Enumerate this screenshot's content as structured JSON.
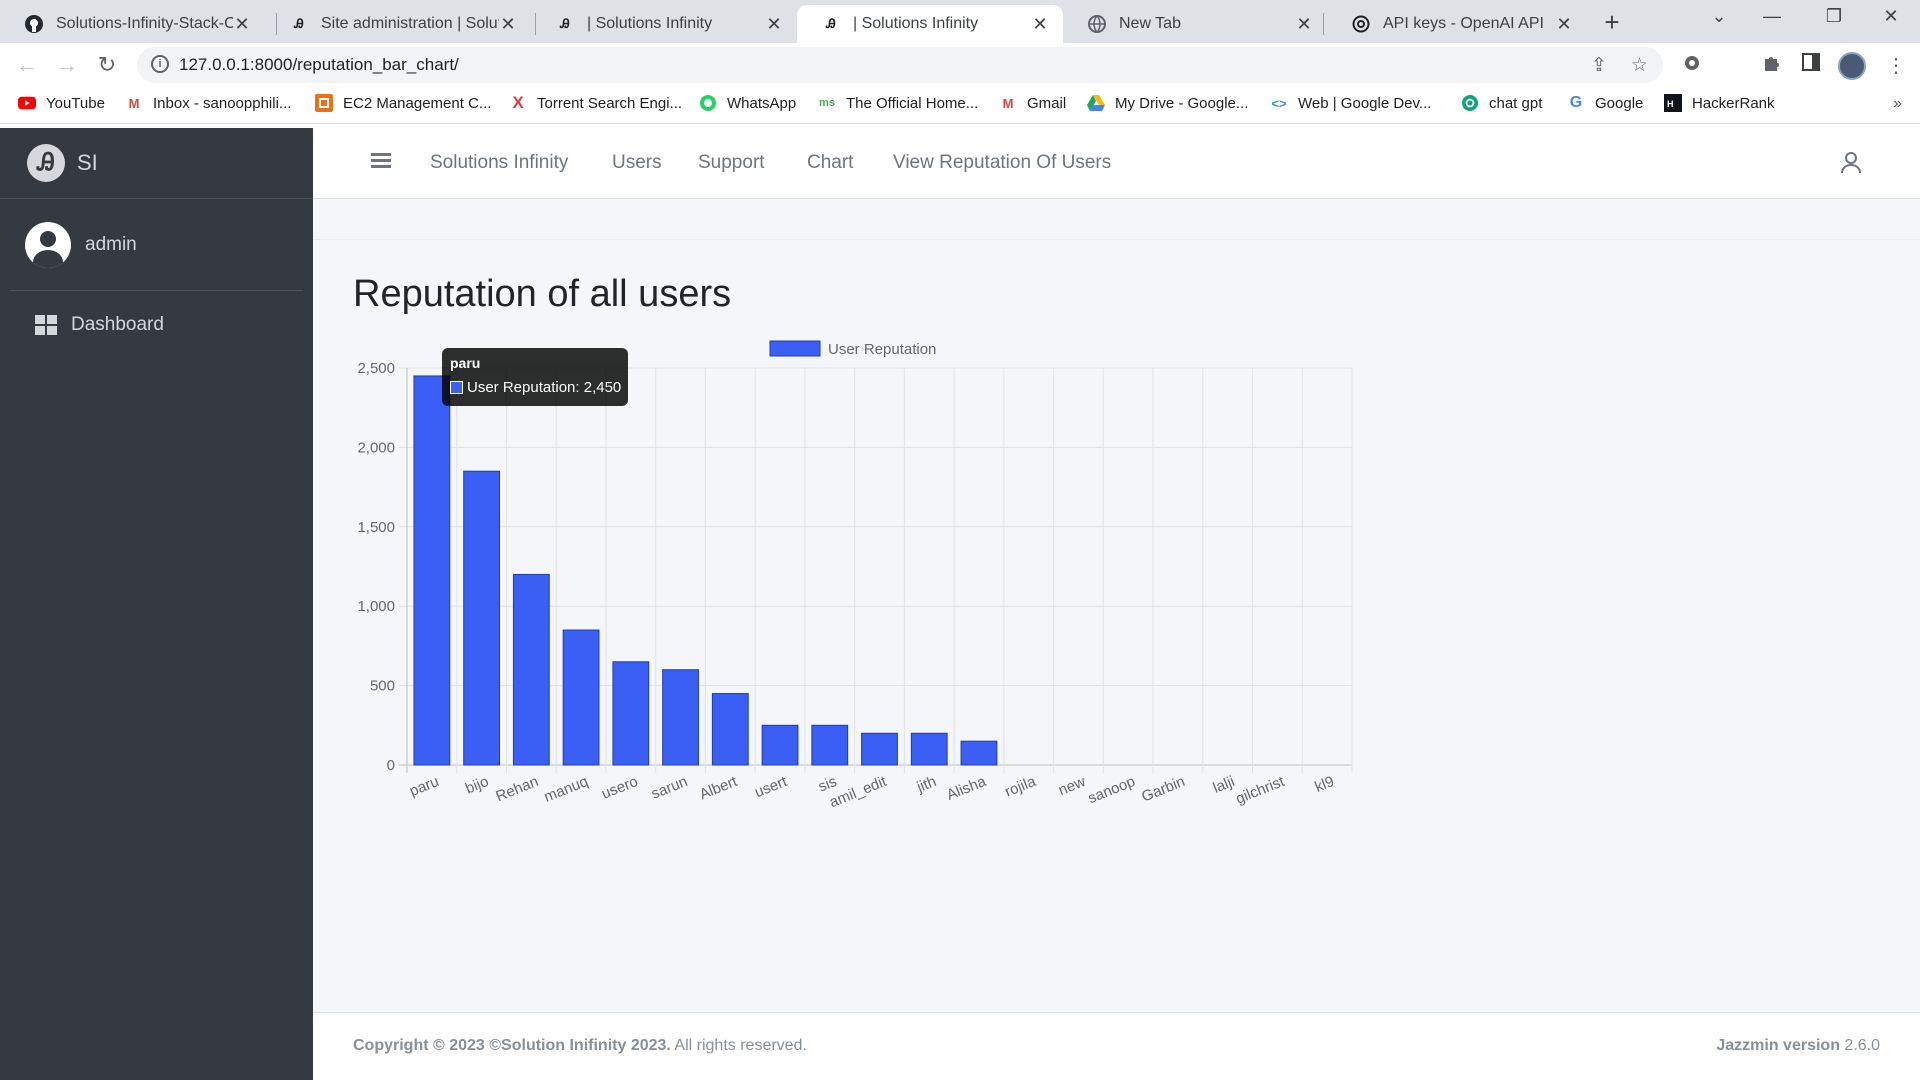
{
  "browser": {
    "tabs": [
      {
        "title": "Solutions-Infinity-Stack-Ove",
        "icon": "github-icon"
      },
      {
        "title": "Site administration | Solutio",
        "icon": "app-logo-icon"
      },
      {
        "title": "| Solutions Infinity",
        "icon": "app-logo-icon"
      },
      {
        "title": "| Solutions Infinity",
        "icon": "app-logo-icon"
      },
      {
        "title": "New Tab",
        "icon": "globe-icon"
      },
      {
        "title": "API keys - OpenAI API",
        "icon": "openai-icon"
      }
    ],
    "active_tab": 3,
    "url": "127.0.0.1:8000/reputation_bar_chart/",
    "bookmarks": [
      {
        "label": "YouTube",
        "icon": "youtube-icon",
        "color": "#ff0000"
      },
      {
        "label": "Inbox - sanoopphili...",
        "icon": "gmail-icon",
        "color": "#ea4335"
      },
      {
        "label": "EC2 Management C...",
        "icon": "aws-icon",
        "color": "#e8711a"
      },
      {
        "label": "Torrent Search Engi...",
        "icon": "x-icon",
        "color": "#e53935"
      },
      {
        "label": "WhatsApp",
        "icon": "whatsapp-icon",
        "color": "#25d366"
      },
      {
        "label": "The Official Home...",
        "icon": "site-icon",
        "color": "#4caf50"
      },
      {
        "label": "Gmail",
        "icon": "gmail-icon",
        "color": "#ea4335"
      },
      {
        "label": "My Drive - Google...",
        "icon": "drive-icon",
        "color": "#1fa463"
      },
      {
        "label": "Web | Google Dev...",
        "icon": "code-icon",
        "color": "#4285f4"
      },
      {
        "label": "chat gpt",
        "icon": "openai-icon",
        "color": "#10a37f"
      },
      {
        "label": "Google",
        "icon": "google-icon",
        "color": "#4285f4"
      },
      {
        "label": "HackerRank",
        "icon": "hackerrank-icon",
        "color": "#1ba94c"
      }
    ],
    "bookmarks_more": "»"
  },
  "sidebar": {
    "brand": "SI",
    "user": "admin",
    "items": [
      {
        "label": "Dashboard",
        "icon": "dashboard-icon"
      }
    ]
  },
  "header": {
    "nav": [
      "Solutions Infinity",
      "Users",
      "Support",
      "Chart",
      "View Reputation Of Users"
    ]
  },
  "page": {
    "title": "Reputation of all users"
  },
  "chart_data": {
    "type": "bar",
    "title": "",
    "categories": [
      "paru",
      "bijo",
      "Rehan",
      "manuq",
      "usero",
      "sarun",
      "Albert",
      "usert",
      "sis",
      "amil_edit",
      "jith",
      "Alisha",
      "rojila",
      "new",
      "sanoop",
      "Garbin",
      "lalji",
      "gilchrist",
      "kl9"
    ],
    "series": [
      {
        "name": "User Reputation",
        "values": [
          2450,
          1850,
          1200,
          850,
          650,
          600,
          450,
          250,
          250,
          200,
          200,
          150,
          0,
          0,
          0,
          0,
          0,
          0,
          0
        ]
      }
    ],
    "y_ticks": [
      "0",
      "500",
      "1,000",
      "1,500",
      "2,000",
      "2,500"
    ],
    "ylim": [
      0,
      2500
    ],
    "grid": true,
    "legend": "top",
    "bar_color": "#3b5ef5",
    "bar_border": "#1f3fa8",
    "tooltip": {
      "title": "paru",
      "body": "User Reputation: 2,450"
    }
  },
  "footer": {
    "copyright": "Copyright © 2023 ©Solution Inifinity 2023.",
    "rights": " All rights reserved.",
    "version_label": "Jazzmin version",
    "version": " 2.6.0"
  }
}
